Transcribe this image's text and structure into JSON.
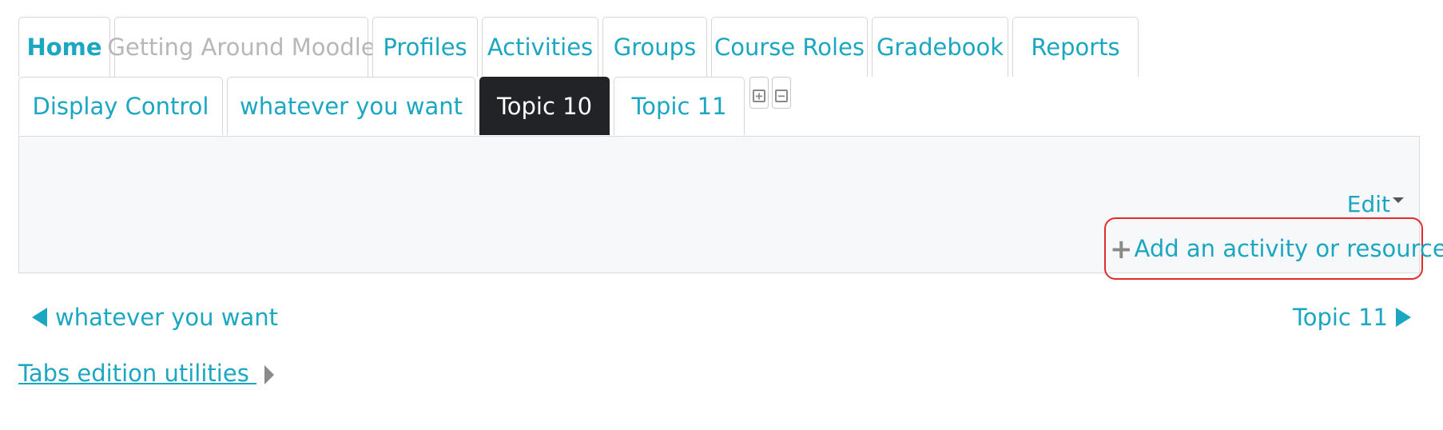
{
  "tabs_row1": [
    {
      "label": "Home"
    },
    {
      "label": "Getting Around Moodle"
    },
    {
      "label": "Profiles"
    },
    {
      "label": "Activities"
    },
    {
      "label": "Groups"
    },
    {
      "label": "Course Roles"
    },
    {
      "label": "Gradebook"
    },
    {
      "label": "Reports"
    }
  ],
  "tabs_row2": [
    {
      "label": "Display Control"
    },
    {
      "label": "whatever you want"
    },
    {
      "label": "Topic 10"
    },
    {
      "label": "Topic 11"
    }
  ],
  "section": {
    "edit_label": "Edit",
    "add_label": "Add an activity or resource"
  },
  "nav": {
    "prev_label": "whatever you want",
    "next_label": "Topic 11"
  },
  "utilities": {
    "label": "Tabs edition utilities "
  },
  "colors": {
    "accent": "#1ba6c1",
    "active_tab": "#222326",
    "highlight": "#e12b2b"
  },
  "icons": {
    "expand": "plus-box-icon",
    "collapse": "minus-box-icon"
  }
}
